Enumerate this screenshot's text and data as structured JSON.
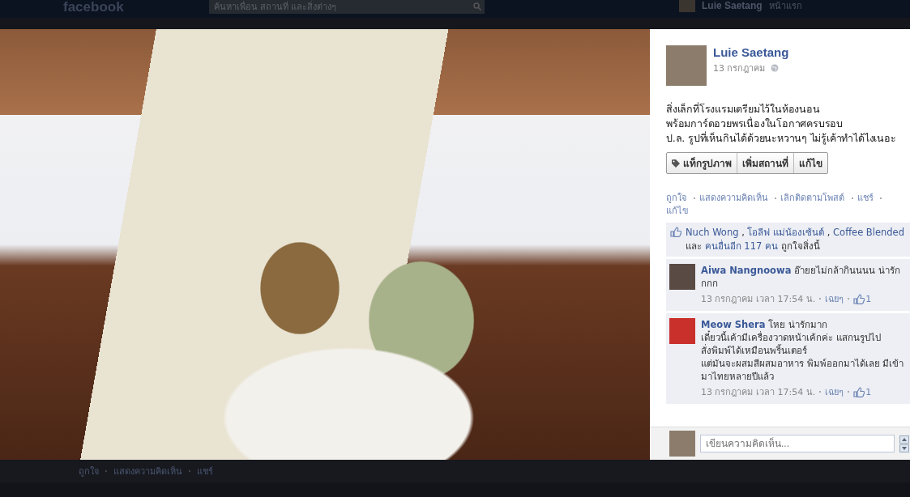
{
  "top_bar": {
    "logo": "facebook",
    "search": {
      "placeholder": "ค้นหาเพื่อน สถานที่ และสิ่งต่างๆ"
    },
    "user_name": "Luie Saetang",
    "home_link": "หน้าแรก"
  },
  "background_actions": [
    "ถูกใจ",
    "แสดงความคิดเห็น",
    "แชร์"
  ],
  "post": {
    "author": "Luie Saetang",
    "date": "13 กรกฎาคม",
    "text_lines": [
      "สิ่งเล็กที่โรงแรมเตรียมไว้ในห้องนอน",
      "พร้อมการ์ดอวยพรเนื่องในโอกาศครบรอบ",
      "ป.ล. รูปที่เห็นกินได้ด้วยนะหวานๆ ไม่รู้เค้าทำได้ไงเนอะ"
    ],
    "buttons": [
      {
        "label": "แท็กรูปภาพ",
        "kind": "tag"
      },
      {
        "label": "เพิ่มสถานที่",
        "kind": "plain"
      },
      {
        "label": "แก้ไข",
        "kind": "plain"
      }
    ],
    "actions": [
      "ถูกใจ",
      "แสดงความคิดเห็น",
      "เลิกติดตามโพสต์",
      "แชร์",
      "แก้ไข"
    ],
    "likes": [
      {
        "text": "Nuch Wong",
        "link": true
      },
      {
        "text": " , ",
        "link": false
      },
      {
        "text": "โอลีฟ แม่น้องเซ้นต์",
        "link": true
      },
      {
        "text": " , ",
        "link": false
      },
      {
        "text": "Coffee Blended",
        "link": true
      },
      {
        "text": " และ ",
        "link": false
      },
      {
        "text": "คนอื่นอีก 117 คน",
        "link": true
      },
      {
        "text": " ถูกใจสิ่งนี้",
        "link": false
      }
    ],
    "comments": [
      {
        "author": "Aiwa Nangnoowa",
        "text": "อ๊ายยไม่กล้ากินนนน น่ารักกกก",
        "time": "13 กรกฎาคม เวลา 17:54 น.",
        "reaction": "เฉยๆ",
        "like_count": "1",
        "color": "#5a4a44"
      },
      {
        "author": "Meow Shera",
        "text": "โหย น่ารักมาก\nเดี๋ยวนี้เค้ามีเครื่องวาดหน้าเค้กค่ะ แสกนรูปไป\nสั่งพิมพ์ได้เหมือนพริ้นเตอร์\nแต่มันจะผสมสีผสมอาหาร พิมพ์ออกมาได้เลย มีเข้ามาไทยหลายปีแล้ว",
        "time": "13 กรกฎาคม เวลา 17:54 น.",
        "reaction": "เฉยๆ",
        "like_count": "1",
        "color": "#c9302c"
      }
    ],
    "comment_box": {
      "placeholder": "เขียนความคิดเห็น..."
    }
  }
}
